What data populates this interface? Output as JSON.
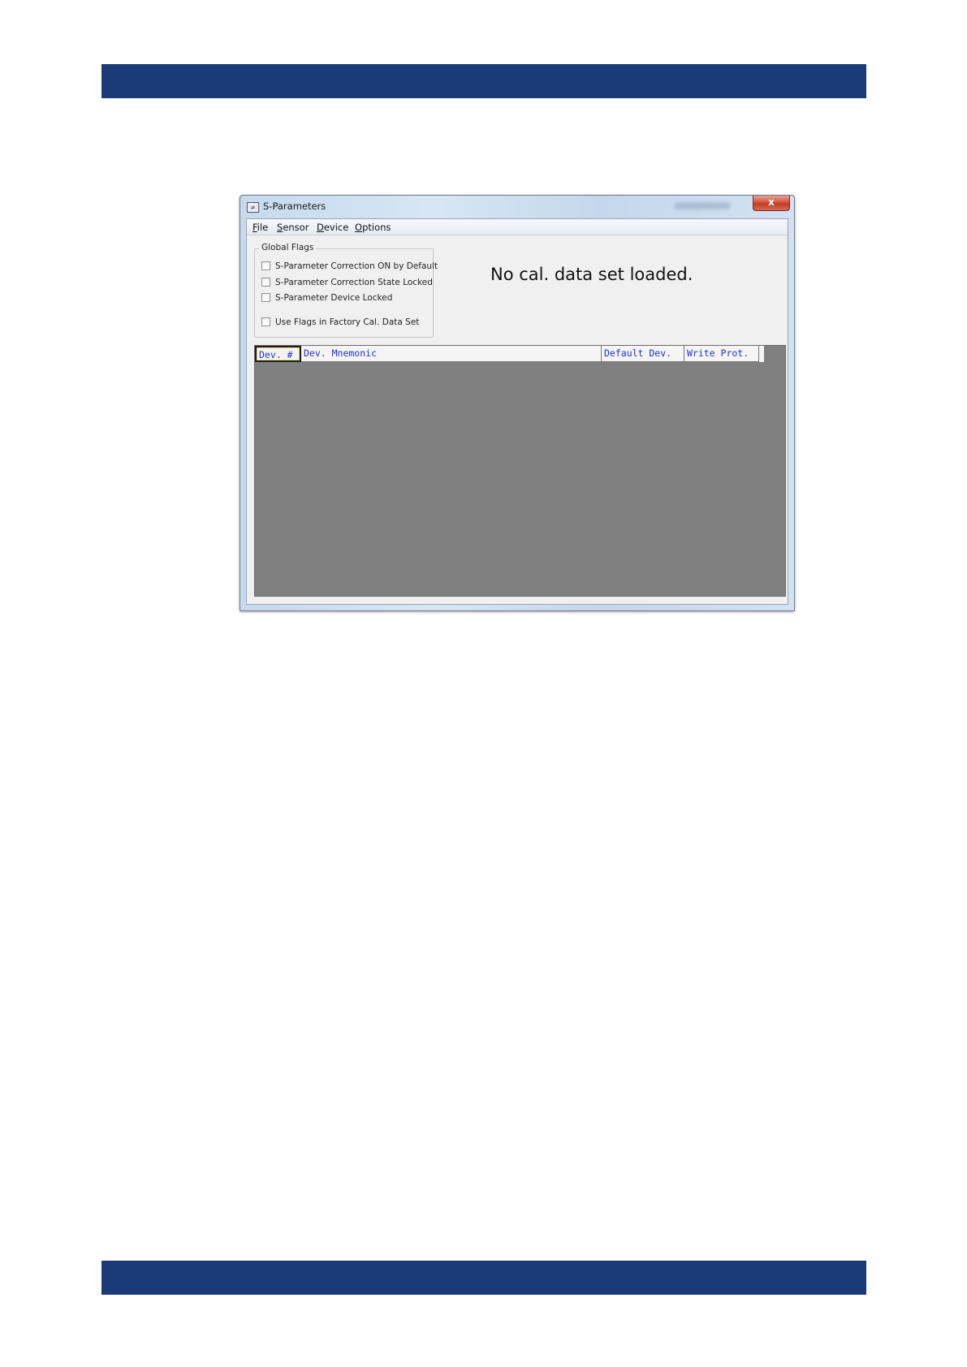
{
  "colors": {
    "header_band": "#1b3a78",
    "grid_background": "#808080",
    "column_header_text": "#2030e0"
  },
  "window": {
    "title": "S-Parameters",
    "icon": "sparam-app-icon",
    "close_label": "x"
  },
  "menu": {
    "items": [
      {
        "accel": "F",
        "rest": "ile"
      },
      {
        "accel": "S",
        "rest": "ensor"
      },
      {
        "accel": "D",
        "rest": "evice"
      },
      {
        "accel": "O",
        "rest": "ptions"
      }
    ]
  },
  "global_flags": {
    "legend": "Global Flags",
    "items": [
      {
        "label": "S-Parameter Correction ON by Default",
        "checked": false
      },
      {
        "label": "S-Parameter Correction State Locked",
        "checked": false
      },
      {
        "label": "S-Parameter Device Locked",
        "checked": false
      },
      {
        "label": "Use Flags in Factory Cal. Data Set",
        "checked": false
      }
    ]
  },
  "status_message": "No cal. data set loaded.",
  "device_table": {
    "columns": [
      "Dev. #",
      "Dev. Mnemonic",
      "Default Dev.",
      "Write Prot."
    ],
    "rows": []
  }
}
